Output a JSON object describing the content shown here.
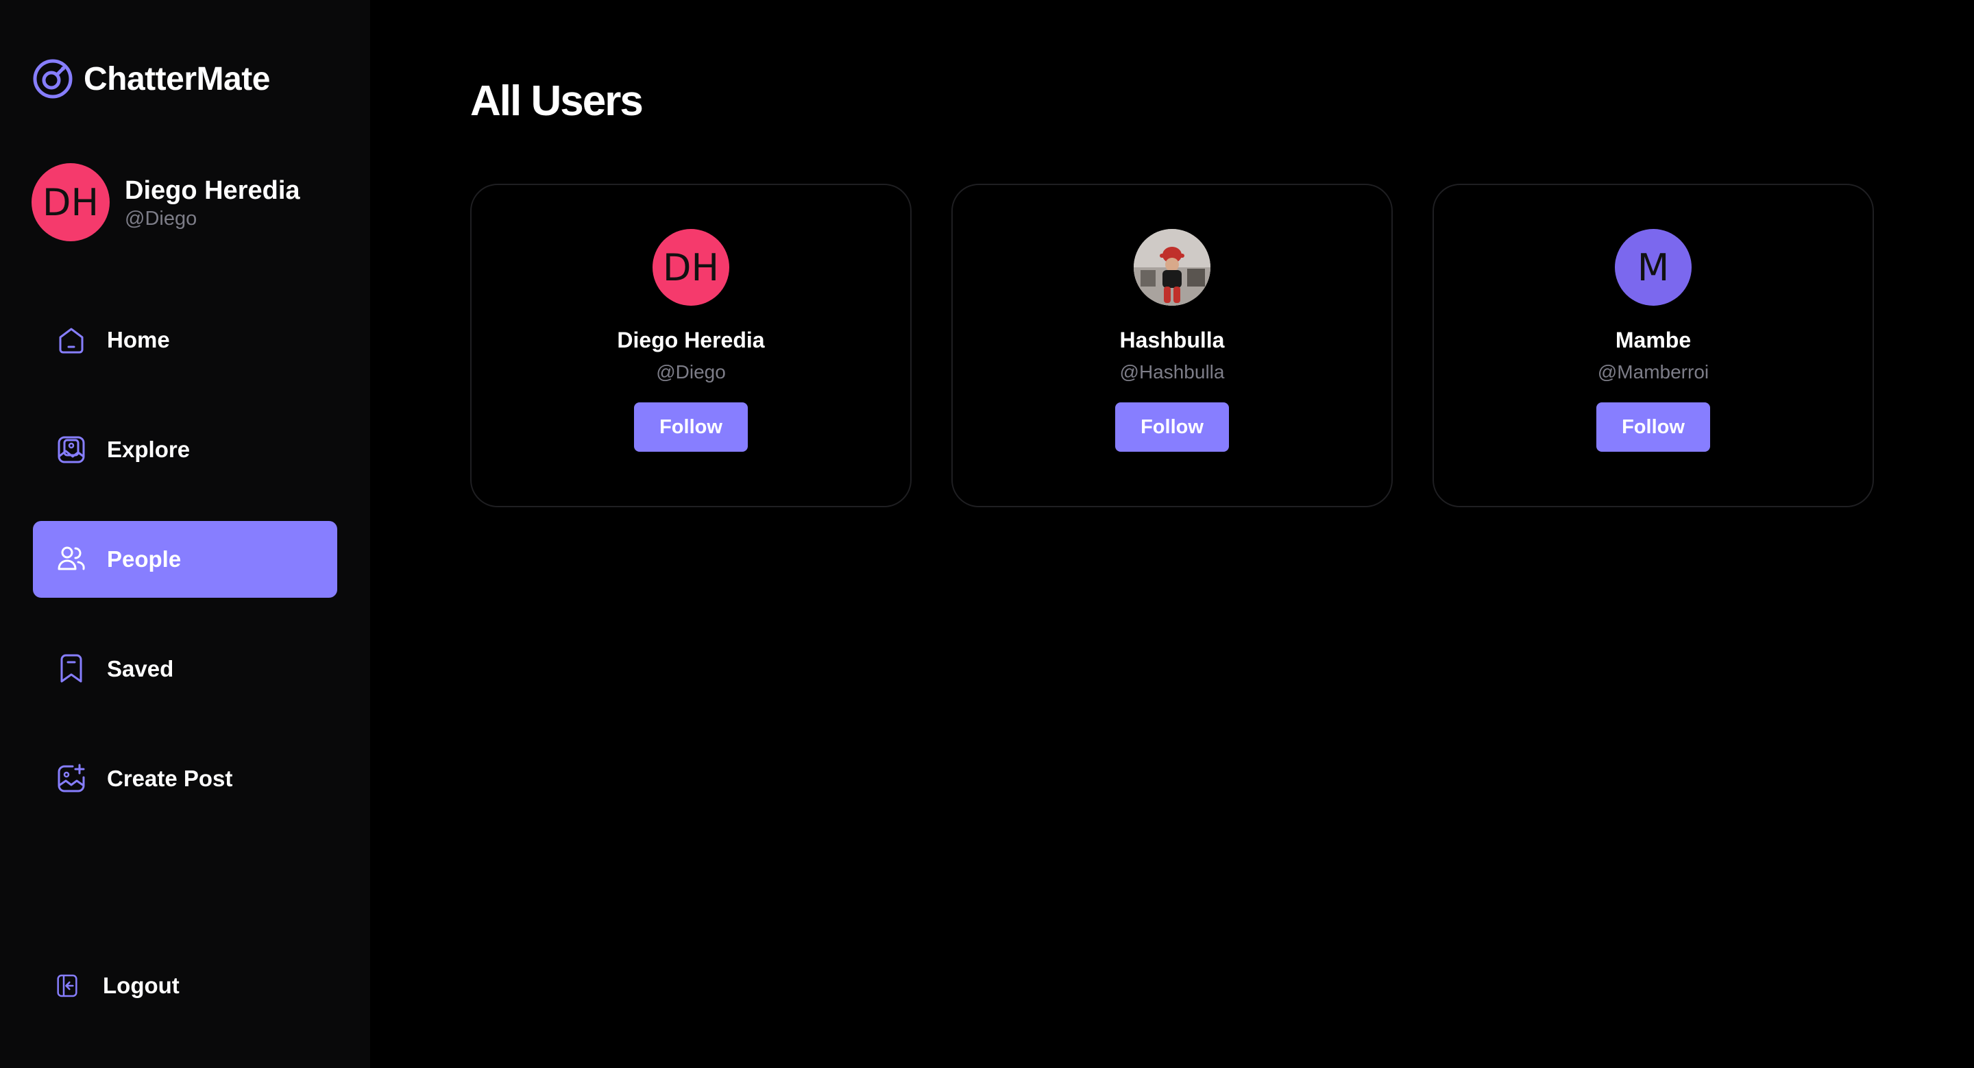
{
  "app": {
    "name": "ChatterMate",
    "accent": "#877eff"
  },
  "current_user": {
    "initials": "DH",
    "name": "Diego Heredia",
    "handle": "@Diego",
    "avatar_color": "#f53a6c"
  },
  "nav": {
    "items": [
      {
        "label": "Home",
        "icon": "home-icon",
        "active": false
      },
      {
        "label": "Explore",
        "icon": "gallery-icon",
        "active": false
      },
      {
        "label": "People",
        "icon": "people-icon",
        "active": true
      },
      {
        "label": "Saved",
        "icon": "bookmark-icon",
        "active": false
      },
      {
        "label": "Create Post",
        "icon": "gallery-add-icon",
        "active": false
      }
    ],
    "logout": {
      "label": "Logout",
      "icon": "logout-icon"
    }
  },
  "page": {
    "title": "All Users"
  },
  "users": [
    {
      "initials": "DH",
      "name": "Diego Heredia",
      "handle": "@Diego",
      "avatar_color": "#f53a6c",
      "follow_label": "Follow"
    },
    {
      "initials": "",
      "name": "Hashbulla",
      "handle": "@Hashbulla",
      "avatar_color": "#c8c4c0",
      "follow_label": "Follow"
    },
    {
      "initials": "M",
      "name": "Mambe",
      "handle": "@Mamberroi",
      "avatar_color": "#7b68ee",
      "follow_label": "Follow"
    }
  ]
}
